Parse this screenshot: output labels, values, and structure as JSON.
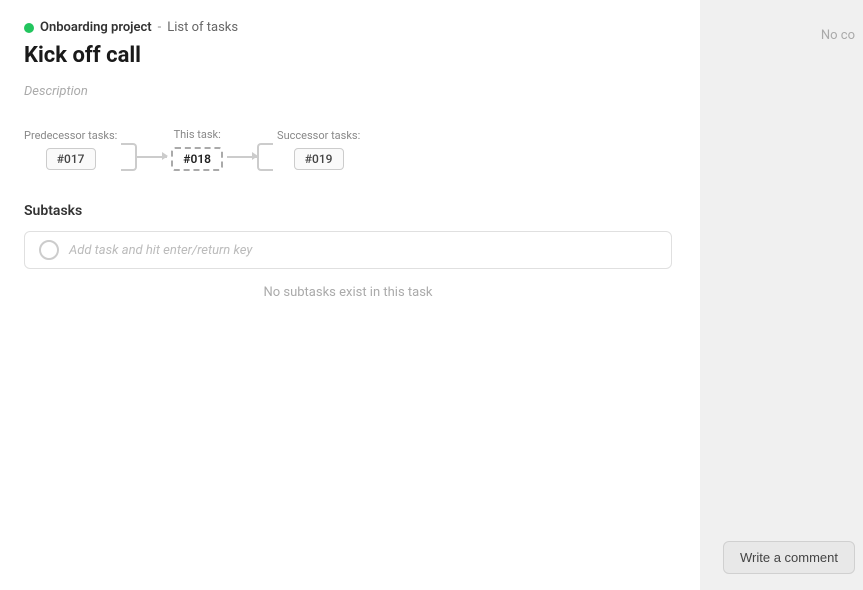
{
  "breadcrumb": {
    "project": "Onboarding project",
    "separator": "-",
    "list": "List of tasks"
  },
  "task": {
    "title": "Kick off call",
    "description_placeholder": "Description"
  },
  "flow": {
    "predecessor_label": "Predecessor tasks:",
    "predecessor_id": "#017",
    "current_label": "This task:",
    "current_id": "#018",
    "successor_label": "Successor tasks:",
    "successor_id": "#019"
  },
  "subtasks": {
    "section_label": "Subtasks",
    "input_placeholder": "Add task and hit enter/return key",
    "empty_message": "No subtasks exist in this task"
  },
  "right_panel": {
    "no_comments": "No co",
    "write_comment_btn": "Write a comment"
  },
  "colors": {
    "green_dot": "#22c55e",
    "border_dashed": "#aaa",
    "connector": "#ccc"
  }
}
